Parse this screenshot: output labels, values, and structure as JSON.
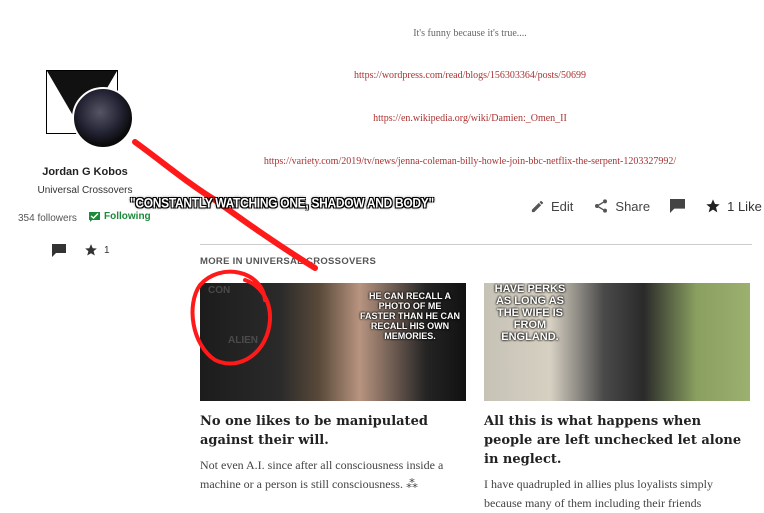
{
  "post": {
    "caption": "It's funny because it's true....",
    "links": [
      "https://wordpress.com/read/blogs/156303364/posts/50699",
      "https://en.wikipedia.org/wiki/Damien:_Omen_II",
      "https://variety.com/2019/tv/news/jenna-coleman-billy-howle-join-bbc-netflix-the-serpent-1203327992/"
    ]
  },
  "author": {
    "name": "Jordan G Kobos",
    "publication": "Universal Crossovers",
    "followers": "354 followers",
    "follow_label": "Following",
    "like_count": "1"
  },
  "actions": {
    "edit": "Edit",
    "share": "Share",
    "like": "1 Like"
  },
  "overlay_text": "\"CONSTANTLY WATCHING ONE, SHADOW AND BODY\"",
  "more_heading": "MORE IN UNIVERSAL CROSSOVERS",
  "cards": [
    {
      "image_caption": "HE CAN RECALL A PHOTO OF ME FASTER THAN HE CAN RECALL HIS OWN MEMORIES.",
      "title": "No one likes to be manipulated against their will.",
      "excerpt": "Not even A.I. since after all consciousness inside a machine or a person is still consciousness. ⁂"
    },
    {
      "image_caption": "HAVE PERKS AS LONG AS THE WIFE IS FROM ENGLAND.",
      "title": "All this is what happens when people are left unchecked let alone in neglect.",
      "excerpt": "I have quadrupled in allies plus loyalists simply because many of them including their friends"
    }
  ],
  "colors": {
    "link": "#a33333",
    "following": "#1b8a3a",
    "annotation": "#ff1a1a"
  }
}
